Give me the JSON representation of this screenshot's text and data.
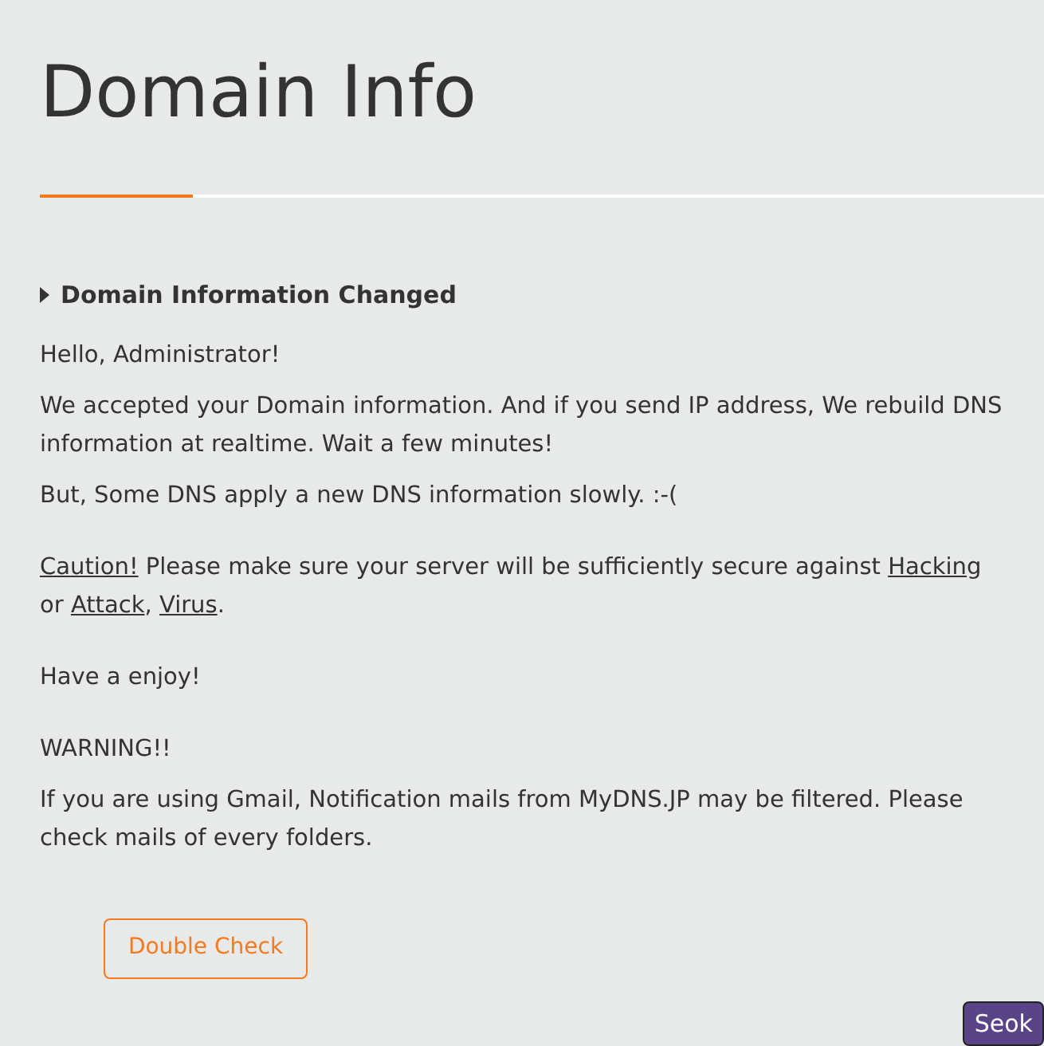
{
  "title": "Domain Info",
  "section_heading": "Domain Information Changed",
  "paragraphs": [
    {
      "segments": [
        {
          "kind": "text",
          "text": "Hello, Administrator!"
        }
      ]
    },
    {
      "segments": [
        {
          "kind": "text",
          "text": "We accepted your Domain information. And if you send IP address, We rebuild DNS information at realtime. Wait a few minutes!"
        }
      ]
    },
    {
      "segments": [
        {
          "kind": "text",
          "text": "But, Some DNS apply a new DNS information slowly. :-("
        }
      ]
    },
    {
      "segments": [
        {
          "kind": "link",
          "text": "Caution!"
        },
        {
          "kind": "text",
          "text": " Please make sure your server will be sufficiently secure against "
        },
        {
          "kind": "link",
          "text": "Hacking"
        },
        {
          "kind": "text",
          "text": " or "
        },
        {
          "kind": "link",
          "text": "Attack"
        },
        {
          "kind": "text",
          "text": ", "
        },
        {
          "kind": "link",
          "text": "Virus"
        },
        {
          "kind": "text",
          "text": "."
        }
      ]
    },
    {
      "segments": [
        {
          "kind": "text",
          "text": "Have a enjoy!"
        }
      ]
    },
    {
      "segments": [
        {
          "kind": "text",
          "text": "WARNING!!"
        }
      ]
    },
    {
      "segments": [
        {
          "kind": "text",
          "text": "If you are using Gmail, Notification mails from MyDNS.JP may be filtered. Please check mails of every folders."
        }
      ]
    }
  ],
  "button": "Double Check",
  "corner_button": "Seok"
}
